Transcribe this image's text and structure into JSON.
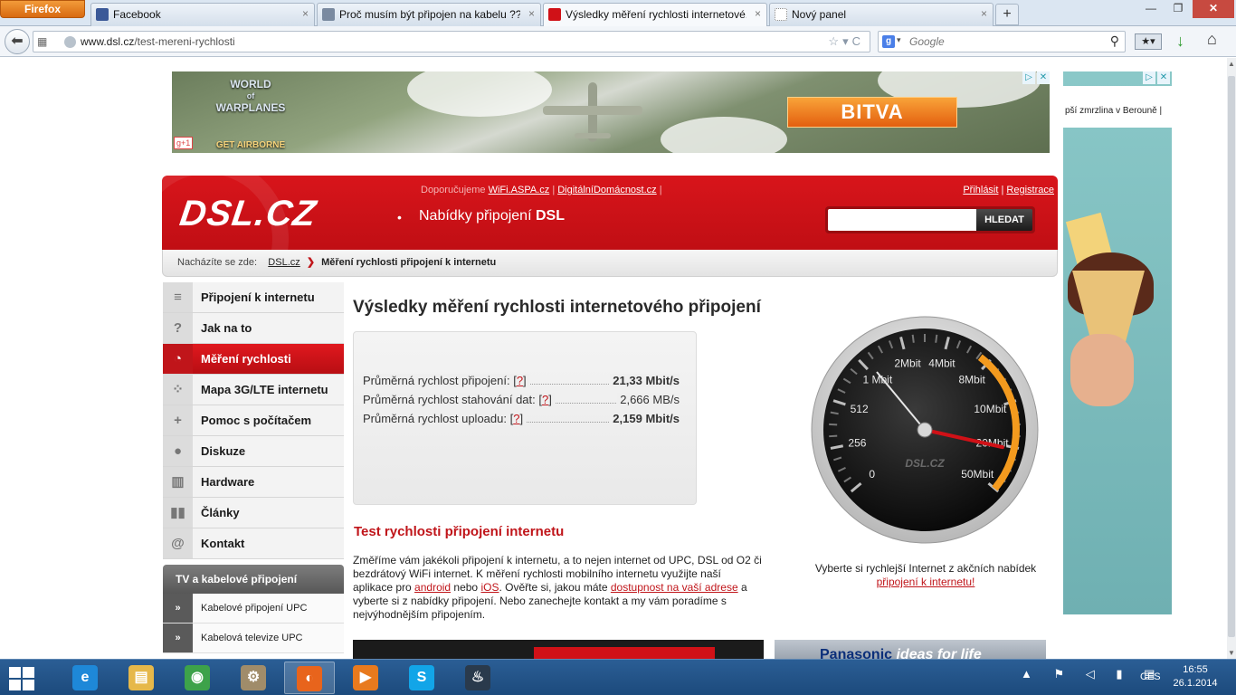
{
  "browser": {
    "menu_button": "Firefox",
    "tabs": [
      {
        "title": "Facebook",
        "icon": "facebook-icon",
        "color": "#3b5998"
      },
      {
        "title": "Proč musím být připojen na kabelu ??",
        "icon": "page-icon",
        "color": "#7a8aa0"
      },
      {
        "title": "Výsledky měření rychlosti internetové...",
        "icon": "dsl-favicon",
        "color": "#d01117"
      },
      {
        "title": "Nový panel",
        "icon": "blank-page-icon",
        "color": "#ffffff"
      }
    ],
    "tab_close": "×",
    "new_tab": "+",
    "window": {
      "minimize": "—",
      "maximize": "❐",
      "close": "✕"
    },
    "back": "⬅",
    "url_host": "www.dsl.cz",
    "url_path": "/test-mereni-rychlosti",
    "url_actions": "☆▾C",
    "search_engine_letter": "g",
    "search_placeholder": "Google",
    "search_glyph": "⚲",
    "bookmarks_glyph": "★▾",
    "download_glyph": "↓",
    "home_glyph": "⌂"
  },
  "ads": {
    "top_banner": {
      "logo_line1": "WORLD",
      "logo_line2": "of",
      "logo_line3": "WARPLANES",
      "logo_tagline": "GET AIRBORNE",
      "button": "BITVA",
      "gplus": "g+1",
      "adchoice": "▷",
      "adclose": "✕"
    },
    "side_banner": {
      "text": "pší zmrzlina v Berouně |"
    },
    "bottom_right": {
      "brand": "Panasonic",
      "slogan": "ideas for life"
    }
  },
  "header": {
    "logo": "DSL.CZ",
    "logo_dot": "•",
    "tagline_prefix": "Nabídky připojení",
    "tagline_bold": "DSL",
    "recommend_prefix": "Doporučujeme",
    "recommend_link1": "WiFi.ASPA.cz",
    "recommend_sep": "|",
    "recommend_link2": "DigitálníDomácnost.cz",
    "recommend_end": "|",
    "login": "Přihlásit",
    "login_sep": "|",
    "register": "Registrace",
    "search_button": "HLEDAT"
  },
  "breadcrumb": {
    "prefix": "Nacházíte se zde:",
    "home": "DSL.cz",
    "separator": "❯",
    "current": "Měření rychlosti připojení k internetu"
  },
  "sidebar": {
    "items": [
      {
        "label": "Připojení k internetu",
        "icon": "list-icon",
        "glyph": "≡"
      },
      {
        "label": "Jak na to",
        "icon": "question-icon",
        "glyph": "?"
      },
      {
        "label": "Měření rychlosti",
        "icon": "gauge-icon",
        "glyph": "◔"
      },
      {
        "label": "Mapa 3G/LTE internetu",
        "icon": "map-dots-icon",
        "glyph": "⁘"
      },
      {
        "label": "Pomoc s počítačem",
        "icon": "plus-icon",
        "glyph": "+"
      },
      {
        "label": "Diskuze",
        "icon": "chat-icon",
        "glyph": "●"
      },
      {
        "label": "Hardware",
        "icon": "hardware-icon",
        "glyph": "▥"
      },
      {
        "label": "Články",
        "icon": "articles-icon",
        "glyph": "▮▮"
      },
      {
        "label": "Kontakt",
        "icon": "at-icon",
        "glyph": "@"
      }
    ],
    "sub_heading": "TV a kabelové připojení",
    "sub_items": [
      {
        "label": "Kabelové připojení UPC",
        "glyph": "»"
      },
      {
        "label": "Kabelová televize UPC",
        "glyph": "»"
      }
    ]
  },
  "main": {
    "title": "Výsledky měření rychlosti internetového připojení",
    "results": [
      {
        "label": "Průměrná rychlost připojení:",
        "help": "?",
        "value": "21,33 Mbit/s",
        "strong": true
      },
      {
        "label": "Průměrná rychlost stahování dat:",
        "help": "?",
        "value": "2,666 MB/s",
        "strong": false
      },
      {
        "label": "Průměrná rychlost uploadu:",
        "help": "?",
        "value": "2,159 Mbit/s",
        "strong": true
      }
    ],
    "test_title": "Test rychlosti připojení internetu",
    "test_desc": {
      "part1": "Změříme vám jakékoli připojení k internetu, a to nejen internet od UPC, DSL od O2 či bezdrátový WiFi internet. K měření rychlosti mobilního internetu využijte naší aplikace pro ",
      "link_android": "android",
      "part2": " nebo ",
      "link_ios": "iOS",
      "part3": ". Ověřte si, jakou máte ",
      "link_availability": "dostupnost na vaší adrese",
      "part4": " a vyberte si z nabídky připojení. Nebo zanechejte kontakt a my vám poradíme s nejvýhodnějším připojením."
    }
  },
  "gauge": {
    "brand": "DSL.CZ",
    "scale_labels": [
      "0",
      "256",
      "512",
      "1 Mbit",
      "2Mbit",
      "4Mbit",
      "8Mbit",
      "10Mbit",
      "20Mbit",
      "50Mbit"
    ],
    "needle_label": "21,33 Mbit/s",
    "caption_text": "Vyberte si rychlejší Internet z akčních nabídek",
    "caption_link": "připojení k internetu!",
    "accent": "#f39a1e",
    "needle_color": "#d01117"
  },
  "taskbar": {
    "apps": [
      {
        "name": "internet-explorer",
        "glyph": "e",
        "color": "#1e88d8"
      },
      {
        "name": "file-explorer",
        "glyph": "▤",
        "color": "#e6b84a"
      },
      {
        "name": "chrome",
        "glyph": "◉",
        "color": "#3da24a"
      },
      {
        "name": "settings-app",
        "glyph": "⚙",
        "color": "#a08c6a"
      },
      {
        "name": "firefox",
        "glyph": "◐",
        "color": "#e8641c"
      },
      {
        "name": "media-player",
        "glyph": "▶",
        "color": "#e87a1e"
      },
      {
        "name": "skype",
        "glyph": "S",
        "color": "#12a5e8"
      },
      {
        "name": "steam",
        "glyph": "♨",
        "color": "#2a3a4c"
      }
    ],
    "tray": "▲ ⚑ ◁ ▮ ▤",
    "lang": "CES",
    "time": "16:55",
    "date": "26.1.2014"
  }
}
